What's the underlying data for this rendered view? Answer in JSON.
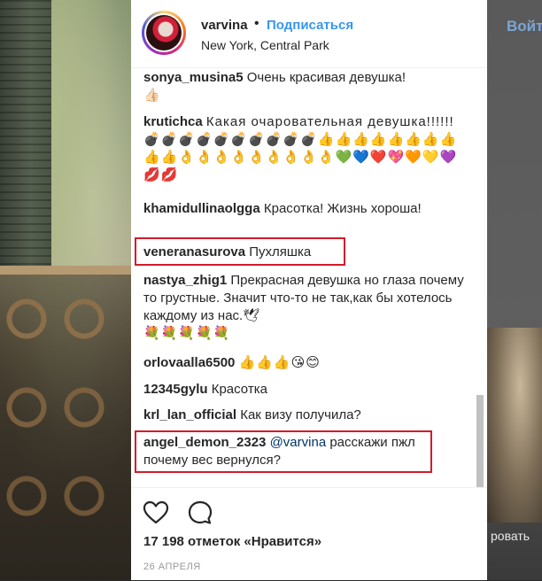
{
  "header": {
    "username": "varvina",
    "separator": "•",
    "subscribe_label": "Подписаться",
    "location": "New York, Central Park"
  },
  "background": {
    "right_top_text": "Войт",
    "right_bottom_text": "ровать"
  },
  "comments": [
    {
      "user": "sonya_musina5",
      "text": "Очень красивая девушка!",
      "extra": "👍🏻"
    },
    {
      "user": "krutichca",
      "text": "Какая очаровательная девушка!!!!!!💣💣💣💣💣💣💣💣💣💣👍👍👍👍👍👍👍👍👍👍👌👌👌👌👌👌👌👌👌💚💙❤️💖🧡💛💜💋💋"
    },
    {
      "user": "khamidullinaolgga",
      "text": "Красотка! Жизнь хороша!"
    },
    {
      "user": "veneranasurova",
      "text": "Пухляшка"
    },
    {
      "user": "nastya_zhig1",
      "text": "Прекрасная девушка но глаза почему то грустные. Значит что-то не так,как бы хотелось каждому из нас.🕊",
      "extra": "💐💐💐💐💐"
    },
    {
      "user": "orlovaalla6500",
      "text": "👍👍👍😘😊"
    },
    {
      "user": "12345gylu",
      "text": "Красотка"
    },
    {
      "user": "krl_lan_official",
      "text": "Как визу получила?"
    },
    {
      "user": "angel_demon_2323",
      "mention": "@varvina",
      "text": " расскажи пжл почему вес вернулся?"
    }
  ],
  "likes_text": "17 198 отметок «Нравится»",
  "date": "26 АПРЕЛЯ",
  "icons": {
    "like": "heart-icon",
    "comment": "comment-bubble-icon"
  },
  "colors": {
    "accent": "#3897f0",
    "highlight": "#d21b2b",
    "text": "#262626"
  }
}
